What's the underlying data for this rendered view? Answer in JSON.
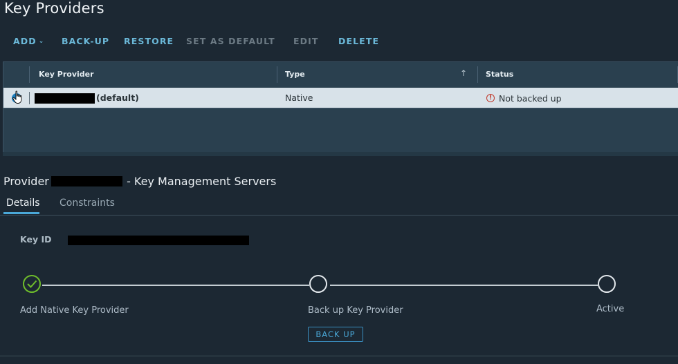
{
  "page": {
    "title": "Key Providers"
  },
  "toolbar": {
    "add": "ADD",
    "backup": "BACK-UP",
    "restore": "RESTORE",
    "set_default": "SET AS DEFAULT",
    "edit": "EDIT",
    "delete": "DELETE"
  },
  "grid": {
    "columns": [
      {
        "label": "Key Provider"
      },
      {
        "label": "Type",
        "sort": "ascending"
      },
      {
        "label": "Status"
      }
    ],
    "rows": [
      {
        "provider_suffix": "(default)",
        "provider_name_redacted": true,
        "type": "Native",
        "status": "Not backed up",
        "status_icon": "alert-circle-icon",
        "selected": true
      }
    ]
  },
  "details": {
    "title_prefix": "Provider",
    "title_suffix": "- Key Management Servers",
    "tabs": [
      {
        "label": "Details",
        "active": true
      },
      {
        "label": "Constraints",
        "active": false
      }
    ],
    "key_id_label": "Key ID",
    "steps": [
      {
        "label": "Add Native Key Provider",
        "state": "complete"
      },
      {
        "label": "Back up Key Provider",
        "state": "pending"
      },
      {
        "label": "Active",
        "state": "pending"
      }
    ],
    "backup_button": "BACK UP"
  },
  "colors": {
    "accent": "#4aa8d8",
    "success": "#6fbe2b",
    "danger": "#c0392b",
    "background": "#1c2833"
  }
}
